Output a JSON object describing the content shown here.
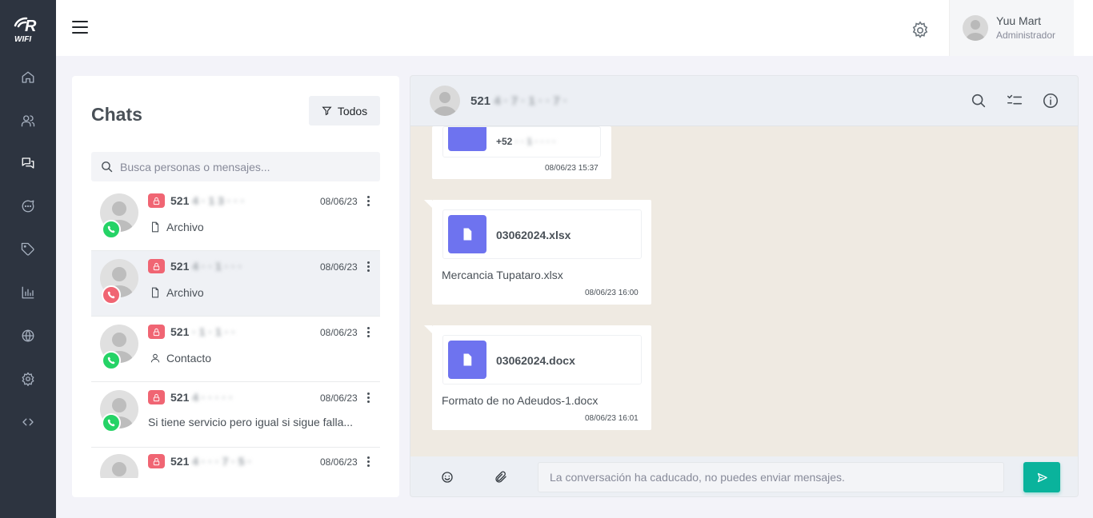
{
  "brand": {
    "logo_text": "R",
    "logo_sub": "WIFI"
  },
  "sidebar": {
    "items": [
      {
        "icon": "home-icon",
        "active": false
      },
      {
        "icon": "users-icon",
        "active": false
      },
      {
        "icon": "chats-icon",
        "active": true
      },
      {
        "icon": "message-circle-icon",
        "active": false
      },
      {
        "icon": "tag-icon",
        "active": false
      },
      {
        "icon": "bar-chart-icon",
        "active": false
      },
      {
        "icon": "globe-icon",
        "active": false
      },
      {
        "icon": "settings-icon",
        "active": false
      },
      {
        "icon": "code-icon",
        "active": false
      }
    ]
  },
  "header": {
    "user": {
      "name": "Yuu Mart",
      "role": "Administrador"
    }
  },
  "chats": {
    "title": "Chats",
    "filter_label": "Todos",
    "search_placeholder": "Busca personas o mensajes...",
    "items": [
      {
        "name": "521",
        "name_hidden": "4 · 1 3 · · ·",
        "date": "08/06/23",
        "message": "Archivo",
        "message_icon": "file-icon",
        "channel": "whatsapp",
        "selected": false
      },
      {
        "name": "521",
        "name_hidden": "4 · · 1 · · ·",
        "date": "08/06/23",
        "message": "Archivo",
        "message_icon": "file-icon",
        "channel": "call",
        "selected": true
      },
      {
        "name": "521",
        "name_hidden": "· 1 · 1 · ·",
        "date": "08/06/23",
        "message": "Contacto",
        "message_icon": "user-icon",
        "channel": "whatsapp",
        "selected": false
      },
      {
        "name": "521",
        "name_hidden": "4 · · · · ·",
        "date": "08/06/23",
        "message": "Si tiene servicio pero igual si sigue falla...",
        "message_icon": "",
        "channel": "whatsapp",
        "selected": false
      },
      {
        "name": "521",
        "name_hidden": "4 · · · 7 · 5 ·",
        "date": "08/06/23",
        "message": "",
        "message_icon": "",
        "channel": "whatsapp",
        "selected": false
      }
    ]
  },
  "conversation": {
    "contact_name": "521",
    "contact_hidden": "4 · 7 · 1 · · 7 ·",
    "messages": [
      {
        "type": "contact",
        "contact_number": "+52",
        "contact_hidden": "· · 1 · · · ·",
        "time": "08/06/23 15:37"
      },
      {
        "type": "file",
        "file_name": "03062024.xlsx",
        "caption": "Mercancia Tupataro.xlsx",
        "time": "08/06/23 16:00"
      },
      {
        "type": "file",
        "file_name": "03062024.docx",
        "caption": "Formato de no Adeudos-1.docx",
        "time": "08/06/23 16:01"
      }
    ],
    "composer_placeholder": "La conversación ha caducado, no puedes enviar mensajes."
  },
  "colors": {
    "sidebar_bg": "#2d3440",
    "accent_green": "#0ab39c",
    "file_icon_bg": "#6e73ef",
    "lock_red": "#f06573",
    "whatsapp_green": "#25d366",
    "chat_bg": "#efeae2"
  }
}
